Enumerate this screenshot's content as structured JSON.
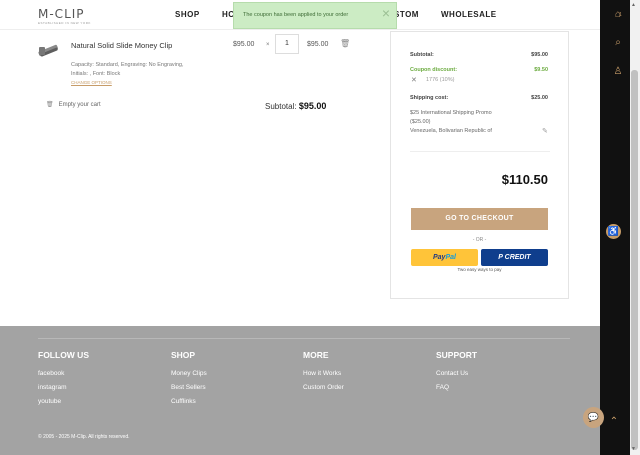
{
  "header": {
    "logo": "M-CLIP",
    "logo_tagline": "ESTABLISHED IN NEW YORK",
    "nav": [
      "SHOP",
      "HC",
      "STOM",
      "WHOLESALE"
    ]
  },
  "toast": {
    "message": "The coupon has been applied to your order",
    "close": "×"
  },
  "cart": {
    "item": {
      "name": "Natural Solid Slide Money Clip",
      "meta_line1": "Capacity: Standard, Engraving: No Engraving,",
      "meta_line2": "Initials: , Font: Block",
      "change_link": "CHANGE OPTIONS",
      "price": "$95.00",
      "times": "×",
      "quantity": "1",
      "line_total": "$95.00"
    },
    "empty_cart_label": "Empty your cart",
    "subtotal_label": "Subtotal:",
    "subtotal_value": "$95.00"
  },
  "summary": {
    "subtotal_label": "Subtotal:",
    "subtotal_value": "$95.00",
    "coupon_label": "Coupon discount:",
    "coupon_value": "$9.50",
    "coupon_code": "1776 (10%)",
    "shipping_label": "Shipping cost:",
    "shipping_value": "$25.00",
    "shipping_method_1": "$25 International Shipping Promo",
    "shipping_method_2": "($25.00)",
    "shipping_country": "Venezuela, Bolivarian Republic of",
    "total": "$110.50",
    "checkout_label": "GO TO CHECKOUT",
    "or_label": "- OR -",
    "paypal_a": "Pay",
    "paypal_b": "Pal",
    "credit_label": "CREDIT",
    "easy_pay": "Two easy ways to pay"
  },
  "footer": {
    "follow": {
      "title": "FOLLOW US",
      "links": [
        "facebook",
        "instagram",
        "youtube"
      ]
    },
    "shop": {
      "title": "SHOP",
      "links": [
        "Money Clips",
        "Best Sellers",
        "Cufflinks"
      ]
    },
    "more": {
      "title": "MORE",
      "links": [
        "How it Works",
        "Custom Order"
      ]
    },
    "support": {
      "title": "SUPPORT",
      "links": [
        "Contact Us",
        "FAQ"
      ]
    },
    "copyright": "© 2005 - 2025 M-Clip. All rights reserved."
  },
  "sidebar": {
    "cart_count": "1"
  },
  "colors": {
    "accent": "#c8a47e",
    "dark": "#111111",
    "footer": "#a3a3a3",
    "green": "#6bab3f"
  }
}
